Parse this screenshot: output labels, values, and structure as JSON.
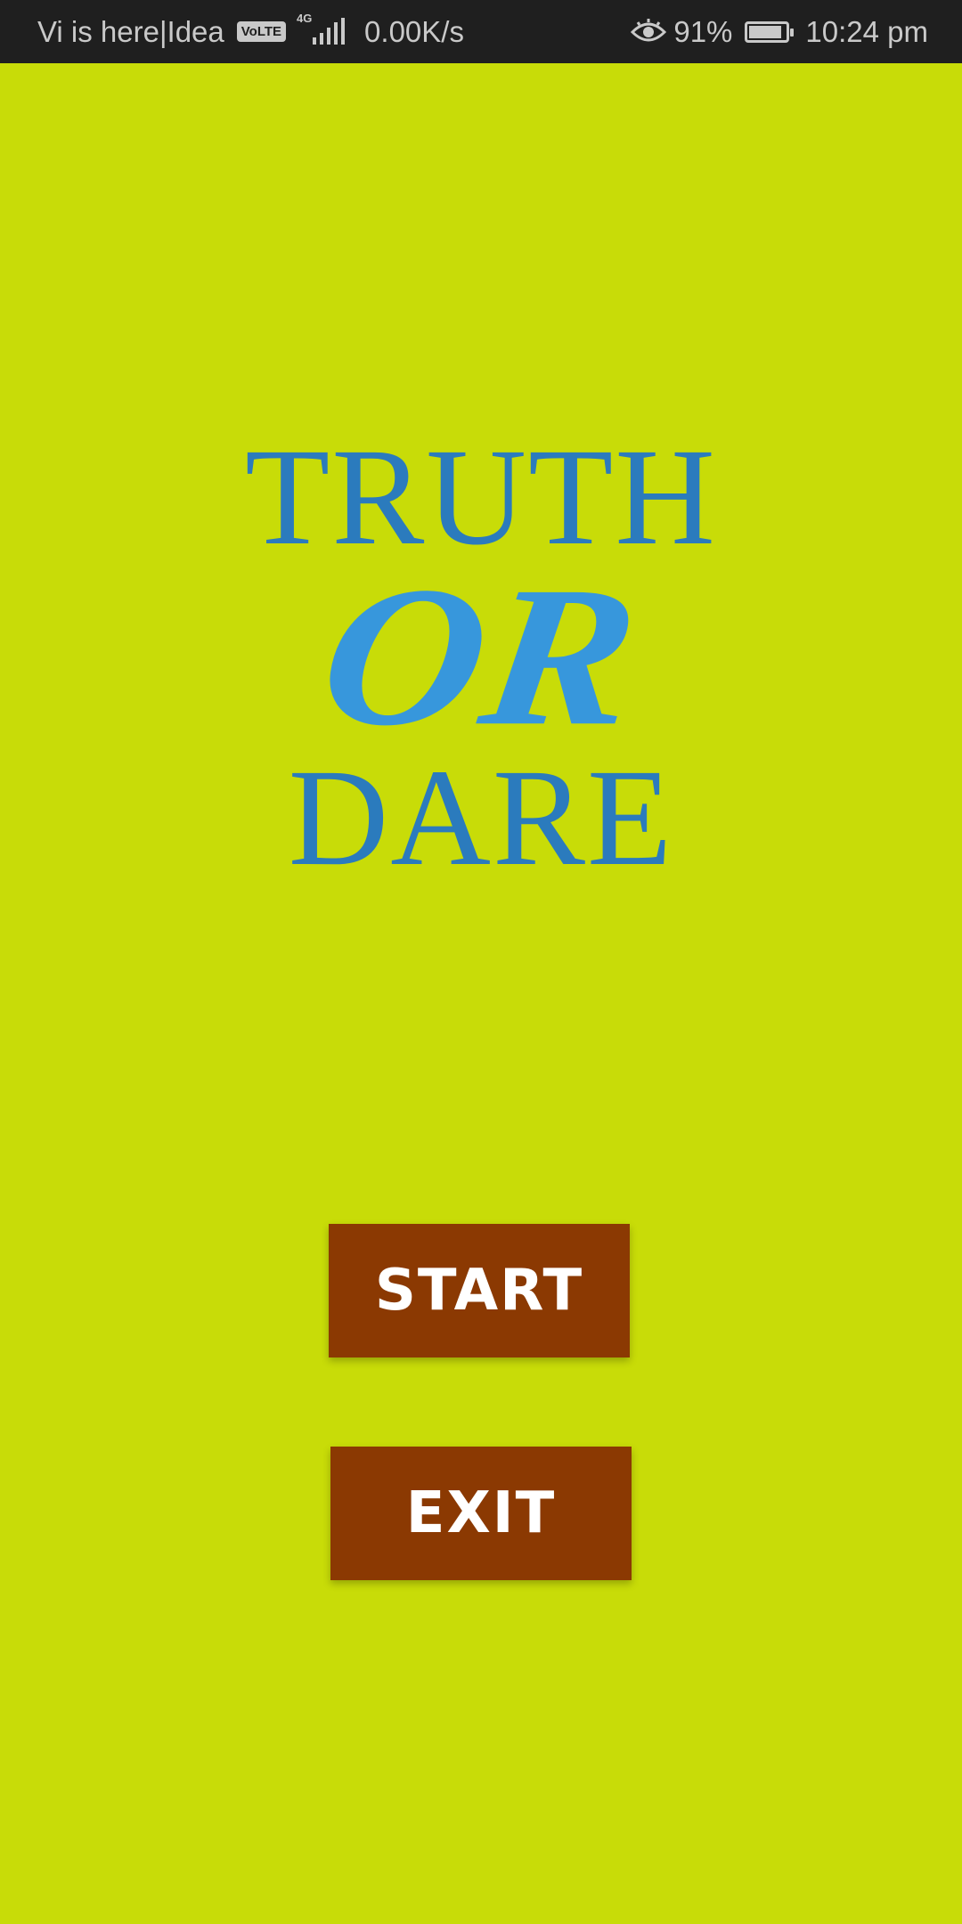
{
  "status_bar": {
    "carrier": "Vi is here|Idea",
    "volte_label": "VoLTE",
    "network_type": "4G",
    "network_speed": "0.00K/s",
    "battery_percent": "91%",
    "battery_level": 0.91,
    "time": "10:24 pm",
    "icons": [
      "eye-comfort-icon",
      "signal-icon",
      "battery-icon"
    ]
  },
  "logo": {
    "line1": "TRUTH",
    "line2": "OR",
    "line3": "DARE"
  },
  "buttons": {
    "start_label": "START",
    "exit_label": "EXIT"
  },
  "colors": {
    "background": "#c8dc08",
    "button_background": "#8b3902",
    "logo_dark_blue": "#2b7bbd",
    "logo_light_blue": "#3797dc",
    "status_bar_background": "#1f1f1f"
  }
}
